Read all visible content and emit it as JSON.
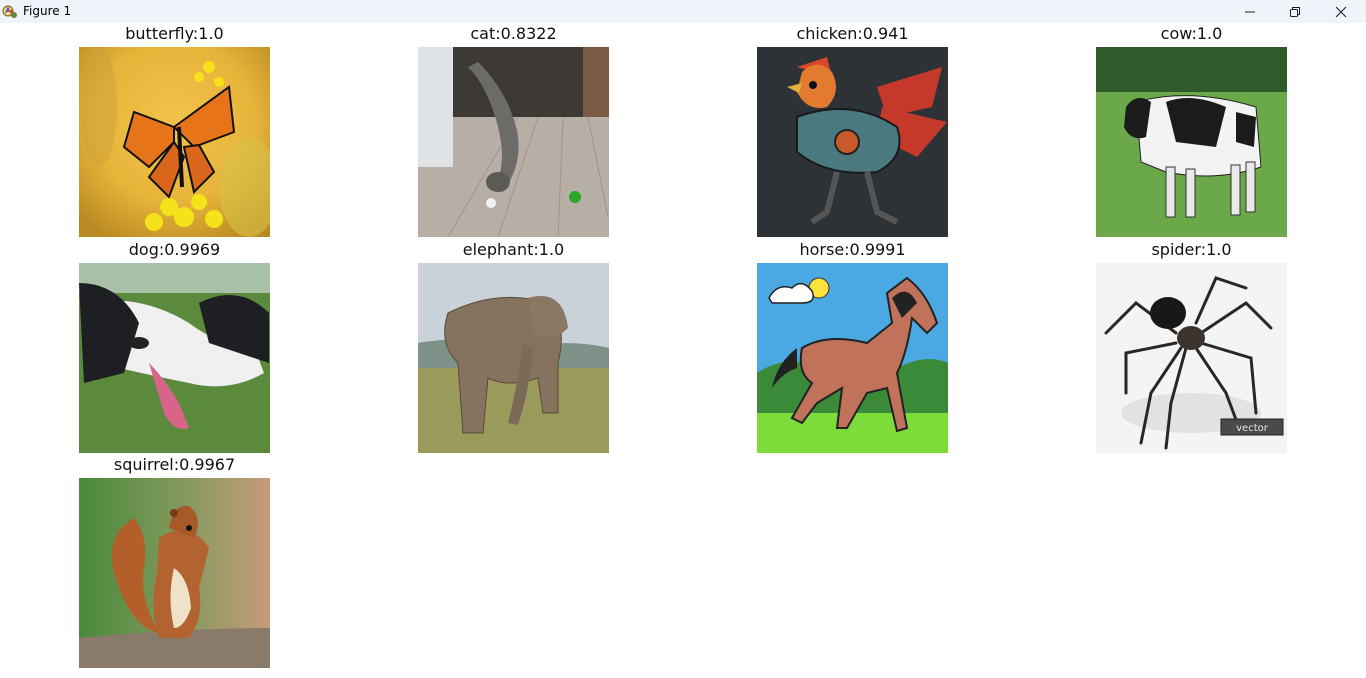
{
  "window": {
    "title": "Figure 1"
  },
  "controls": {
    "minimize_icon": "minimize-icon",
    "maximize_icon": "restore-icon",
    "close_icon": "close-icon"
  },
  "subplots": [
    {
      "label": "butterfly",
      "score": "1.0",
      "title": "butterfly:1.0"
    },
    {
      "label": "cat",
      "score": "0.8322",
      "title": "cat:0.8322"
    },
    {
      "label": "chicken",
      "score": "0.941",
      "title": "chicken:0.941"
    },
    {
      "label": "cow",
      "score": "1.0",
      "title": "cow:1.0"
    },
    {
      "label": "dog",
      "score": "0.9969",
      "title": "dog:0.9969"
    },
    {
      "label": "elephant",
      "score": "1.0",
      "title": "elephant:1.0"
    },
    {
      "label": "horse",
      "score": "0.9991",
      "title": "horse:0.9991"
    },
    {
      "label": "spider",
      "score": "1.0",
      "title": "spider:1.0"
    },
    {
      "label": "squirrel",
      "score": "0.9967",
      "title": "squirrel:0.9967"
    }
  ],
  "watermark": {
    "spider_badge": "vector"
  }
}
